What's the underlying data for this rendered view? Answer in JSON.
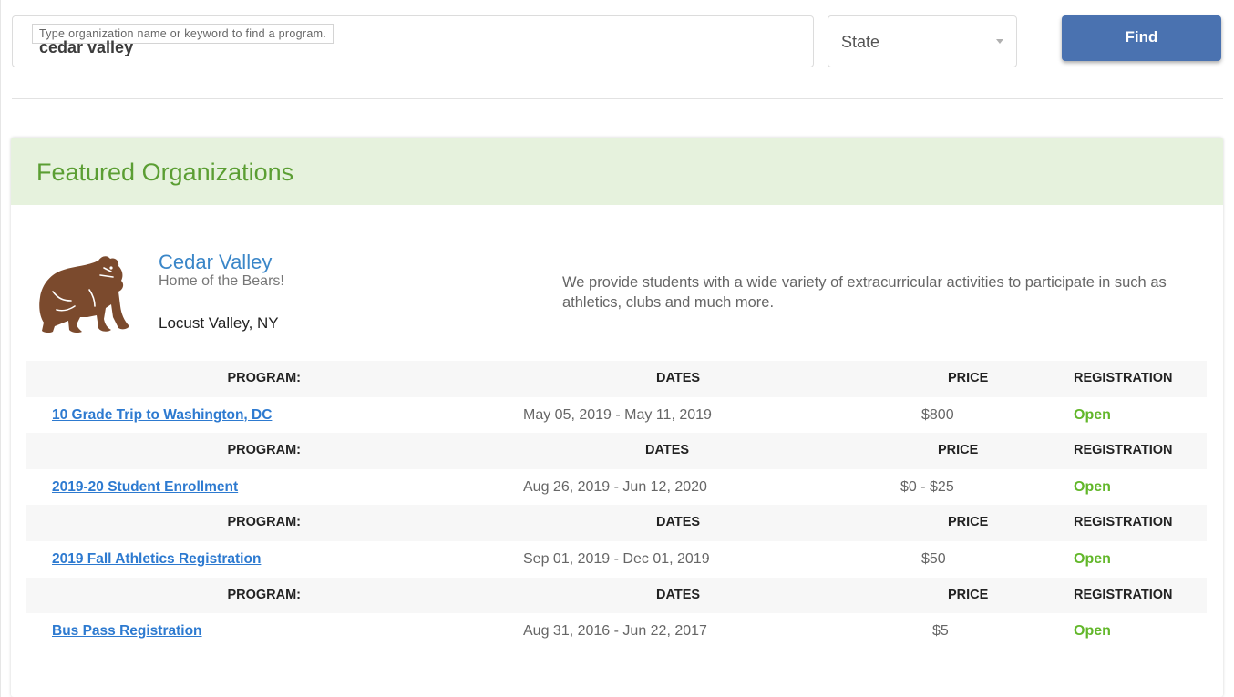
{
  "search": {
    "placeholder": "Type organization name or keyword to find a program.",
    "value": "cedar valley"
  },
  "state_select": {
    "selected": "State"
  },
  "find_button": {
    "label": "Find"
  },
  "featured": {
    "title": "Featured Organizations",
    "header_color": "#e6f2dd",
    "title_color": "#5b9e33"
  },
  "organization": {
    "name": "Cedar Valley",
    "tagline": "Home of the Bears!",
    "location": "Locust Valley, NY",
    "description": "We provide students with a wide variety of extracurricular activities to participate in such as athletics, clubs and much more.",
    "logo_icon": "bear-icon"
  },
  "table_headers": {
    "program": "PROGRAM:",
    "dates": "DATES",
    "price": "PRICE",
    "registration": "REGISTRATION"
  },
  "programs": [
    {
      "name": "10 Grade Trip to Washington, DC",
      "dates": "May 05, 2019 - May 11, 2019",
      "price": "$800",
      "registration": "Open"
    },
    {
      "name": "2019-20 Student Enrollment",
      "dates": "Aug 26, 2019 - Jun 12, 2020",
      "price": "$0 - $25",
      "registration": "Open"
    },
    {
      "name": "2019 Fall Athletics Registration",
      "dates": "Sep 01, 2019 - Dec 01, 2019",
      "price": "$50",
      "registration": "Open"
    },
    {
      "name": "Bus Pass Registration",
      "dates": "Aug 31, 2016 - Jun 22, 2017",
      "price": "$5",
      "registration": "Open"
    }
  ],
  "colors": {
    "find_button": "#4a72b0",
    "link": "#2d7ad0",
    "open_status": "#62b72a"
  }
}
